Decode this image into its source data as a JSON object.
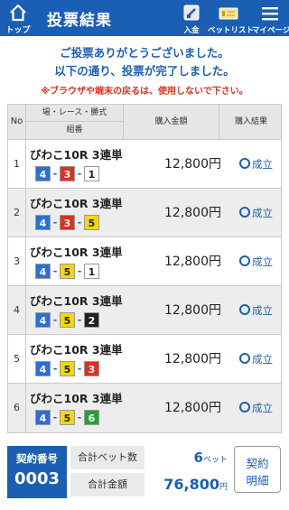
{
  "header": {
    "top_label": "トップ",
    "title": "投票結果",
    "deposit_label": "入金",
    "betlist_label": "ベットリスト",
    "mypage_label": "マイページ",
    "color": "#1a5fb4"
  },
  "messages": {
    "line1": "ご投票ありがとうございました。",
    "line2": "以下の通り、投票が完了しました。",
    "warning": "※ブラウザや端末の戻るは、使用しないで下さい。"
  },
  "table": {
    "headers": {
      "no": "No",
      "race": "場・レース・勝式",
      "combo": "組番",
      "amount": "購入金額",
      "result": "購入結果"
    },
    "rows": [
      {
        "no": "1",
        "race": "びわこ10R 3連単",
        "combo": [
          "4",
          "3",
          "1"
        ],
        "amount": "12,800円",
        "result": "成立"
      },
      {
        "no": "2",
        "race": "びわこ10R 3連単",
        "combo": [
          "4",
          "3",
          "5"
        ],
        "amount": "12,800円",
        "result": "成立"
      },
      {
        "no": "3",
        "race": "びわこ10R 3連単",
        "combo": [
          "4",
          "5",
          "1"
        ],
        "amount": "12,800円",
        "result": "成立"
      },
      {
        "no": "4",
        "race": "びわこ10R 3連単",
        "combo": [
          "4",
          "5",
          "2"
        ],
        "amount": "12,800円",
        "result": "成立"
      },
      {
        "no": "5",
        "race": "びわこ10R 3連単",
        "combo": [
          "4",
          "5",
          "3"
        ],
        "amount": "12,800円",
        "result": "成立"
      },
      {
        "no": "6",
        "race": "びわこ10R 3連単",
        "combo": [
          "4",
          "5",
          "6"
        ],
        "amount": "12,800円",
        "result": "成立"
      }
    ]
  },
  "boat_colors": {
    "1": {
      "bg": "#ffffff",
      "fg": "#222222"
    },
    "2": {
      "bg": "#222222",
      "fg": "#ffffff"
    },
    "3": {
      "bg": "#e0301e",
      "fg": "#ffffff"
    },
    "4": {
      "bg": "#2b6fd6",
      "fg": "#ffffff"
    },
    "5": {
      "bg": "#f5d800",
      "fg": "#222222"
    },
    "6": {
      "bg": "#21a336",
      "fg": "#ffffff"
    }
  },
  "footer": {
    "contract_label": "契約番号",
    "contract_no": "0003",
    "bet_count_label": "合計ベット数",
    "bet_count": "6",
    "bet_unit": "ベット",
    "total_label": "合計金額",
    "total_amount": "76,800",
    "total_unit": "円",
    "detail_line1": "契約",
    "detail_line2": "明細"
  }
}
